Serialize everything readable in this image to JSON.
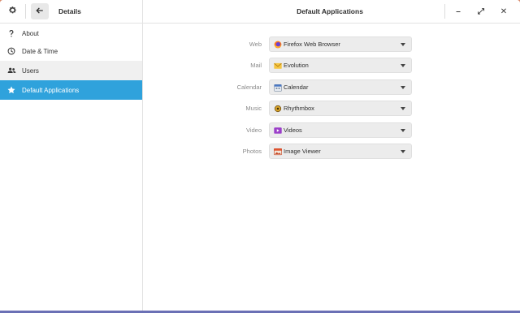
{
  "header": {
    "left_title": "Details",
    "main_title": "Default Applications",
    "minimize_glyph": "–",
    "maximize_glyph": "⤢",
    "close_glyph": "✕"
  },
  "sidebar": {
    "items": [
      {
        "label": "About",
        "icon": "question-icon",
        "state": "normal"
      },
      {
        "label": "Date & Time",
        "icon": "clock-icon",
        "state": "normal"
      },
      {
        "label": "Users",
        "icon": "users-icon",
        "state": "hover"
      },
      {
        "label": "Default Applications",
        "icon": "star-icon",
        "state": "active"
      }
    ]
  },
  "defaults": [
    {
      "label": "Web",
      "app": "Firefox Web Browser",
      "icon": "firefox-icon"
    },
    {
      "label": "Mail",
      "app": "Evolution",
      "icon": "evolution-icon"
    },
    {
      "label": "Calendar",
      "app": "Calendar",
      "icon": "calendar-icon"
    },
    {
      "label": "Music",
      "app": "Rhythmbox",
      "icon": "rhythmbox-icon"
    },
    {
      "label": "Video",
      "app": "Videos",
      "icon": "videos-icon"
    },
    {
      "label": "Photos",
      "app": "Image Viewer",
      "icon": "image-viewer-icon"
    }
  ],
  "colors": {
    "accent": "#2fa2dc",
    "hover": "#f0f0f0"
  }
}
